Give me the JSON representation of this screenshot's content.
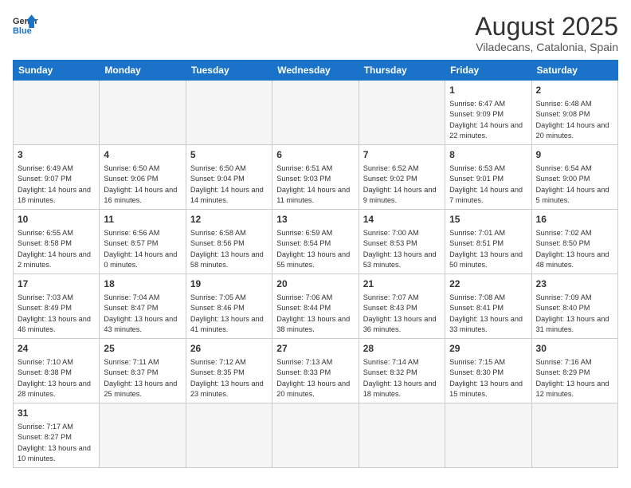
{
  "logo": {
    "text_general": "General",
    "text_blue": "Blue"
  },
  "header": {
    "month_year": "August 2025",
    "location": "Viladecans, Catalonia, Spain"
  },
  "weekdays": [
    "Sunday",
    "Monday",
    "Tuesday",
    "Wednesday",
    "Thursday",
    "Friday",
    "Saturday"
  ],
  "rows": [
    [
      {
        "day": "",
        "info": "",
        "empty": true
      },
      {
        "day": "",
        "info": "",
        "empty": true
      },
      {
        "day": "",
        "info": "",
        "empty": true
      },
      {
        "day": "",
        "info": "",
        "empty": true
      },
      {
        "day": "",
        "info": "",
        "empty": true
      },
      {
        "day": "1",
        "info": "Sunrise: 6:47 AM\nSunset: 9:09 PM\nDaylight: 14 hours and 22 minutes."
      },
      {
        "day": "2",
        "info": "Sunrise: 6:48 AM\nSunset: 9:08 PM\nDaylight: 14 hours and 20 minutes."
      }
    ],
    [
      {
        "day": "3",
        "info": "Sunrise: 6:49 AM\nSunset: 9:07 PM\nDaylight: 14 hours and 18 minutes."
      },
      {
        "day": "4",
        "info": "Sunrise: 6:50 AM\nSunset: 9:06 PM\nDaylight: 14 hours and 16 minutes."
      },
      {
        "day": "5",
        "info": "Sunrise: 6:50 AM\nSunset: 9:04 PM\nDaylight: 14 hours and 14 minutes."
      },
      {
        "day": "6",
        "info": "Sunrise: 6:51 AM\nSunset: 9:03 PM\nDaylight: 14 hours and 11 minutes."
      },
      {
        "day": "7",
        "info": "Sunrise: 6:52 AM\nSunset: 9:02 PM\nDaylight: 14 hours and 9 minutes."
      },
      {
        "day": "8",
        "info": "Sunrise: 6:53 AM\nSunset: 9:01 PM\nDaylight: 14 hours and 7 minutes."
      },
      {
        "day": "9",
        "info": "Sunrise: 6:54 AM\nSunset: 9:00 PM\nDaylight: 14 hours and 5 minutes."
      }
    ],
    [
      {
        "day": "10",
        "info": "Sunrise: 6:55 AM\nSunset: 8:58 PM\nDaylight: 14 hours and 2 minutes."
      },
      {
        "day": "11",
        "info": "Sunrise: 6:56 AM\nSunset: 8:57 PM\nDaylight: 14 hours and 0 minutes."
      },
      {
        "day": "12",
        "info": "Sunrise: 6:58 AM\nSunset: 8:56 PM\nDaylight: 13 hours and 58 minutes."
      },
      {
        "day": "13",
        "info": "Sunrise: 6:59 AM\nSunset: 8:54 PM\nDaylight: 13 hours and 55 minutes."
      },
      {
        "day": "14",
        "info": "Sunrise: 7:00 AM\nSunset: 8:53 PM\nDaylight: 13 hours and 53 minutes."
      },
      {
        "day": "15",
        "info": "Sunrise: 7:01 AM\nSunset: 8:51 PM\nDaylight: 13 hours and 50 minutes."
      },
      {
        "day": "16",
        "info": "Sunrise: 7:02 AM\nSunset: 8:50 PM\nDaylight: 13 hours and 48 minutes."
      }
    ],
    [
      {
        "day": "17",
        "info": "Sunrise: 7:03 AM\nSunset: 8:49 PM\nDaylight: 13 hours and 46 minutes."
      },
      {
        "day": "18",
        "info": "Sunrise: 7:04 AM\nSunset: 8:47 PM\nDaylight: 13 hours and 43 minutes."
      },
      {
        "day": "19",
        "info": "Sunrise: 7:05 AM\nSunset: 8:46 PM\nDaylight: 13 hours and 41 minutes."
      },
      {
        "day": "20",
        "info": "Sunrise: 7:06 AM\nSunset: 8:44 PM\nDaylight: 13 hours and 38 minutes."
      },
      {
        "day": "21",
        "info": "Sunrise: 7:07 AM\nSunset: 8:43 PM\nDaylight: 13 hours and 36 minutes."
      },
      {
        "day": "22",
        "info": "Sunrise: 7:08 AM\nSunset: 8:41 PM\nDaylight: 13 hours and 33 minutes."
      },
      {
        "day": "23",
        "info": "Sunrise: 7:09 AM\nSunset: 8:40 PM\nDaylight: 13 hours and 31 minutes."
      }
    ],
    [
      {
        "day": "24",
        "info": "Sunrise: 7:10 AM\nSunset: 8:38 PM\nDaylight: 13 hours and 28 minutes."
      },
      {
        "day": "25",
        "info": "Sunrise: 7:11 AM\nSunset: 8:37 PM\nDaylight: 13 hours and 25 minutes."
      },
      {
        "day": "26",
        "info": "Sunrise: 7:12 AM\nSunset: 8:35 PM\nDaylight: 13 hours and 23 minutes."
      },
      {
        "day": "27",
        "info": "Sunrise: 7:13 AM\nSunset: 8:33 PM\nDaylight: 13 hours and 20 minutes."
      },
      {
        "day": "28",
        "info": "Sunrise: 7:14 AM\nSunset: 8:32 PM\nDaylight: 13 hours and 18 minutes."
      },
      {
        "day": "29",
        "info": "Sunrise: 7:15 AM\nSunset: 8:30 PM\nDaylight: 13 hours and 15 minutes."
      },
      {
        "day": "30",
        "info": "Sunrise: 7:16 AM\nSunset: 8:29 PM\nDaylight: 13 hours and 12 minutes."
      }
    ],
    [
      {
        "day": "31",
        "info": "Sunrise: 7:17 AM\nSunset: 8:27 PM\nDaylight: 13 hours and 10 minutes.",
        "lastrow": true
      },
      {
        "day": "",
        "info": "",
        "empty": true,
        "lastrow": true
      },
      {
        "day": "",
        "info": "",
        "empty": true,
        "lastrow": true
      },
      {
        "day": "",
        "info": "",
        "empty": true,
        "lastrow": true
      },
      {
        "day": "",
        "info": "",
        "empty": true,
        "lastrow": true
      },
      {
        "day": "",
        "info": "",
        "empty": true,
        "lastrow": true
      },
      {
        "day": "",
        "info": "",
        "empty": true,
        "lastrow": true
      }
    ]
  ]
}
